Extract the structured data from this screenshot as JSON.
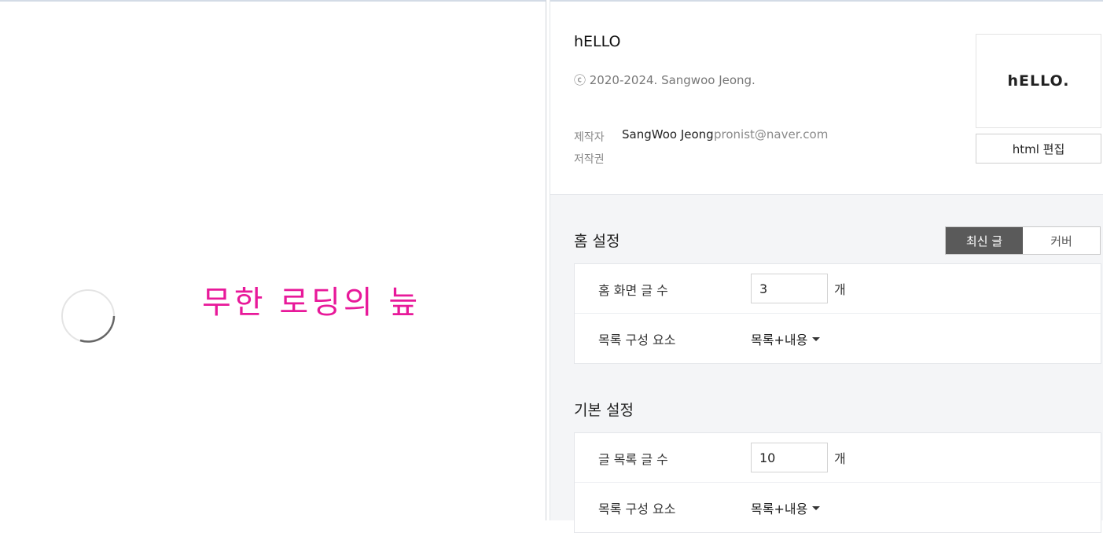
{
  "preview": {
    "loading_text": "무한 로딩의 늪"
  },
  "skin": {
    "title": "hELLO",
    "copyright": "ⓒ 2020-2024. Sangwoo Jeong.",
    "author_label": "제작자",
    "author_name": "SangWoo Jeong",
    "author_email": "pronist@naver.com",
    "license_label": "저작권",
    "thumbnail_text": "hELLO.",
    "html_edit_label": "html 편집"
  },
  "home_settings": {
    "title": "홈 설정",
    "toggle": [
      "최신 글",
      "커버"
    ],
    "rows": {
      "post_count_label": "홈 화면 글 수",
      "post_count_value": "3",
      "post_count_unit": "개",
      "list_component_label": "목록 구성 요소",
      "list_component_value": "목록+내용"
    }
  },
  "basic_settings": {
    "title": "기본 설정",
    "rows": {
      "list_count_label": "글 목록 글 수",
      "list_count_value": "10",
      "list_count_unit": "개",
      "list_component_label": "목록 구성 요소",
      "list_component_value": "목록+내용"
    }
  }
}
